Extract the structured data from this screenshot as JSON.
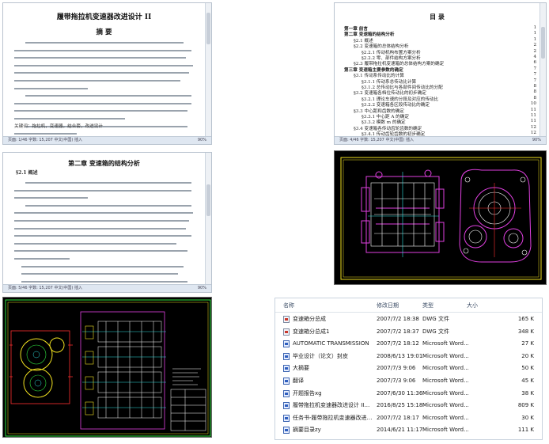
{
  "doc1": {
    "title": "履带拖拉机变速器改进设计 II",
    "subtitle": "摘    要",
    "keywords": "关键词：拖拉机，变速器，结合套，改进设计",
    "status_left": "页面: 1/46   字数: 15,207   中文(中国)   插入",
    "zoom": "90%"
  },
  "doc2": {
    "title": "目    录",
    "toc": [
      {
        "label": "第一章  前言",
        "page": "1"
      },
      {
        "label": "第二章  变速箱的结构分析",
        "page": "1"
      },
      {
        "label": "§2.1 概述",
        "page": "1"
      },
      {
        "label": "§2.2 变速箱的总体结构分析",
        "page": "2"
      },
      {
        "label": "§2.2.1 传动机构布置方案分析",
        "page": "2"
      },
      {
        "label": "§2.2.2 零、部件结构方案分析",
        "page": "4"
      },
      {
        "label": "§2.3 履带拖拉机变速箱的总体结构方案的确定",
        "page": "6"
      },
      {
        "label": "第三章  变速箱主要参数的确定",
        "page": "7"
      },
      {
        "label": "§3.1 传动系传动比的计算",
        "page": "7"
      },
      {
        "label": "§3.1.1 传动系总传动比计算",
        "page": "7"
      },
      {
        "label": "§3.1.2 总传动比与各部件间传动比的分配",
        "page": "8"
      },
      {
        "label": "§3.2 变速箱各档位传动比的初步确定",
        "page": "8"
      },
      {
        "label": "§3.2.1 理论车速的分段及对应的传动比",
        "page": "8"
      },
      {
        "label": "§3.2.2 变速箱各区段传动比的确定",
        "page": "10"
      },
      {
        "label": "§3.3 中心距和齿数的确定",
        "page": "11"
      },
      {
        "label": "§3.3.1 中心距 A 的确定",
        "page": "11"
      },
      {
        "label": "§3.3.2 模数 m 的确定",
        "page": "11"
      },
      {
        "label": "§3.4 变速箱各传动齿轮齿数的确定",
        "page": "12"
      },
      {
        "label": "§3.4.1 传动齿轮齿数的初步确定",
        "page": "12"
      }
    ],
    "status_left": "页面: 4/46   字数: 15,207   中文(中国)   插入",
    "zoom": "90%"
  },
  "doc3": {
    "title": "第二章  变速箱的结构分析",
    "section": "§2.1 概述",
    "status_left": "页面: 5/46   字数: 15,207   中文(中国)   插入",
    "zoom": "90%"
  },
  "explorer": {
    "headers": {
      "name": "名称",
      "date": "修改日期",
      "type": "类型",
      "size": "大小"
    },
    "files": [
      {
        "name": "变速箱分总成",
        "date": "2007/7/2 18:38",
        "type": "DWG 文件",
        "size": "165 K",
        "icon": "dwg-file-icon"
      },
      {
        "name": "变速箱分总成1",
        "date": "2007/7/2 18:37",
        "type": "DWG 文件",
        "size": "348 K",
        "icon": "dwg-file-icon"
      },
      {
        "name": "AUTOMATIC TRANSMISSION",
        "date": "2007/7/2 18:12",
        "type": "Microsoft Word...",
        "size": "27 K",
        "icon": "word-file-icon"
      },
      {
        "name": "毕业设计（论文）封皮",
        "date": "2008/6/13 19:01",
        "type": "Microsoft Word...",
        "size": "20 K",
        "icon": "word-file-icon"
      },
      {
        "name": "大摘要",
        "date": "2007/7/3 9:06",
        "type": "Microsoft Word...",
        "size": "50 K",
        "icon": "word-file-icon"
      },
      {
        "name": "翻译",
        "date": "2007/7/3 9:06",
        "type": "Microsoft Word...",
        "size": "45 K",
        "icon": "word-file-icon"
      },
      {
        "name": "开题报告xg",
        "date": "2007/6/30 11:36",
        "type": "Microsoft Word...",
        "size": "38 K",
        "icon": "word-file-icon"
      },
      {
        "name": "履带拖拉机变速器改进设计 II（有cad图）",
        "date": "2016/8/25 15:18",
        "type": "Microsoft Word...",
        "size": "809 K",
        "icon": "word-file-icon"
      },
      {
        "name": "任务书-履带拖拉机变速器改进设计 II",
        "date": "2007/7/2 18:17",
        "type": "Microsoft Word...",
        "size": "30 K",
        "icon": "word-file-icon"
      },
      {
        "name": "摘要目录zy",
        "date": "2014/6/21 11:17",
        "type": "Microsoft Word...",
        "size": "111 K",
        "icon": "word-file-icon"
      }
    ]
  },
  "colors": {
    "cad_bg": "#000000",
    "cad_magenta": "#e040e0",
    "cad_yellow": "#f0e020",
    "cad_cyan": "#30e0e0",
    "cad_green": "#30e040",
    "cad_red": "#ff3030",
    "word_status_bar": "#dfe7f1"
  }
}
